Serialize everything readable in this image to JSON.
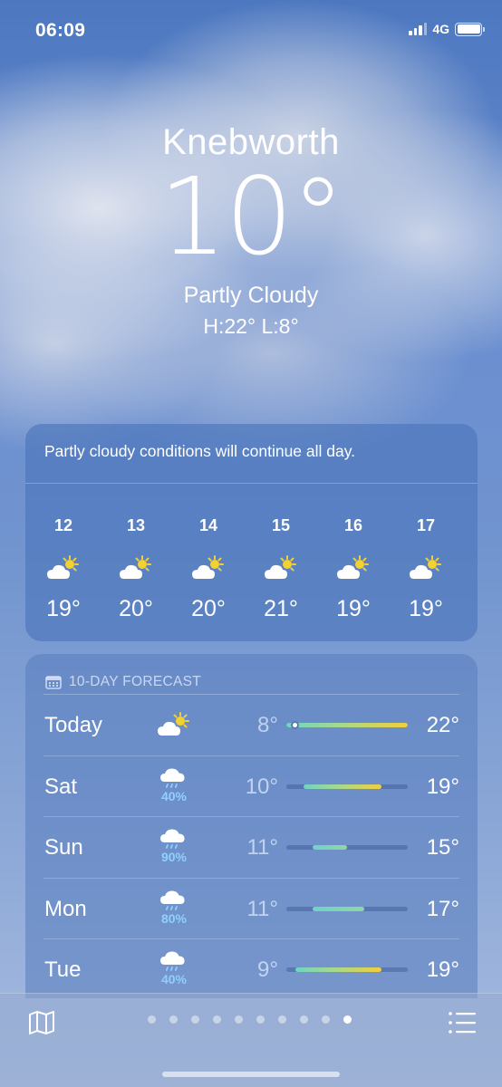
{
  "status": {
    "time": "06:09",
    "network": "4G"
  },
  "location": {
    "city": "Knebworth",
    "temperature": "10°",
    "condition": "Partly Cloudy",
    "hilo": "H:22°  L:8°"
  },
  "hourly": {
    "summary": "Partly cloudy conditions will continue all day.",
    "hours": [
      {
        "time": "12",
        "icon": "partly-cloudy-icon",
        "temp": "19°"
      },
      {
        "time": "13",
        "icon": "partly-cloudy-icon",
        "temp": "20°"
      },
      {
        "time": "14",
        "icon": "partly-cloudy-icon",
        "temp": "20°"
      },
      {
        "time": "15",
        "icon": "partly-cloudy-icon",
        "temp": "21°"
      },
      {
        "time": "16",
        "icon": "partly-cloudy-icon",
        "temp": "19°"
      },
      {
        "time": "17",
        "icon": "partly-cloudy-icon",
        "temp": "19°"
      }
    ]
  },
  "daily": {
    "title": "10-DAY FORECAST",
    "range_min": 8,
    "range_max": 22,
    "days": [
      {
        "day": "Today",
        "icon": "partly-cloudy-icon",
        "pop": "",
        "low": "8°",
        "high": "22°",
        "low_value": 8,
        "high_value": 22,
        "current_value": 9
      },
      {
        "day": "Sat",
        "icon": "rain-cloud-icon",
        "pop": "40%",
        "low": "10°",
        "high": "19°",
        "low_value": 10,
        "high_value": 19
      },
      {
        "day": "Sun",
        "icon": "rain-cloud-icon",
        "pop": "90%",
        "low": "11°",
        "high": "15°",
        "low_value": 11,
        "high_value": 15
      },
      {
        "day": "Mon",
        "icon": "rain-cloud-icon",
        "pop": "80%",
        "low": "11°",
        "high": "17°",
        "low_value": 11,
        "high_value": 17
      },
      {
        "day": "Tue",
        "icon": "rain-cloud-icon",
        "pop": "40%",
        "low": "9°",
        "high": "19°",
        "low_value": 9,
        "high_value": 19
      }
    ]
  },
  "pager": {
    "count": 10,
    "active_index": 9
  },
  "colors": {
    "pop": "#8fd0ff",
    "bar_cool": "#6fd3c7",
    "bar_warm": "#f2cf3a"
  }
}
